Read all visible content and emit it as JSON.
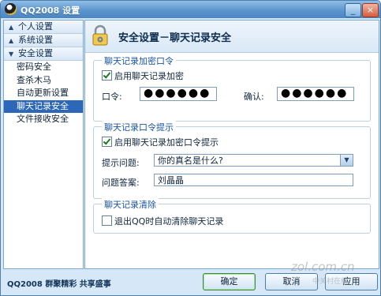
{
  "window": {
    "title": "QQ2008  设置"
  },
  "titlebar": {
    "minimize_glyph": "_",
    "close_glyph": "×"
  },
  "sidebar": {
    "groups": [
      {
        "label": "个人设置"
      },
      {
        "label": "系统设置"
      },
      {
        "label": "安全设置"
      }
    ],
    "items": [
      {
        "label": "密码安全"
      },
      {
        "label": "查杀木马"
      },
      {
        "label": "自动更新设置"
      },
      {
        "label": "聊天记录安全"
      },
      {
        "label": "文件接收安全"
      }
    ],
    "selected_item": "聊天记录安全"
  },
  "panel": {
    "title": "安全设置－聊天记录安全",
    "encrypt": {
      "legend": "聊天记录加密口令",
      "enable_label": "启用聊天记录加密",
      "enable_checked": true,
      "password_label": "口令:",
      "password_value": "●●●●●●",
      "confirm_label": "确认:",
      "confirm_value": "●●●●●●"
    },
    "hint": {
      "legend": "聊天记录口令提示",
      "enable_label": "启用聊天记录加密口令提示",
      "enable_checked": true,
      "question_label": "提示问题:",
      "question_value": "你的真名是什么?",
      "answer_label": "问题答案:",
      "answer_value": "刘晶晶"
    },
    "clear": {
      "legend": "聊天记录清除",
      "option_label": "退出QQ时自动清除聊天记录",
      "option_checked": false
    }
  },
  "footer": {
    "slogan": "QQ2008  群聚精彩  共享盛事",
    "ok_label": "确定",
    "cancel_label": "取消",
    "apply_label": "应用"
  },
  "watermark": {
    "line1": "zol.com.cn",
    "line2": "中关村在线"
  }
}
